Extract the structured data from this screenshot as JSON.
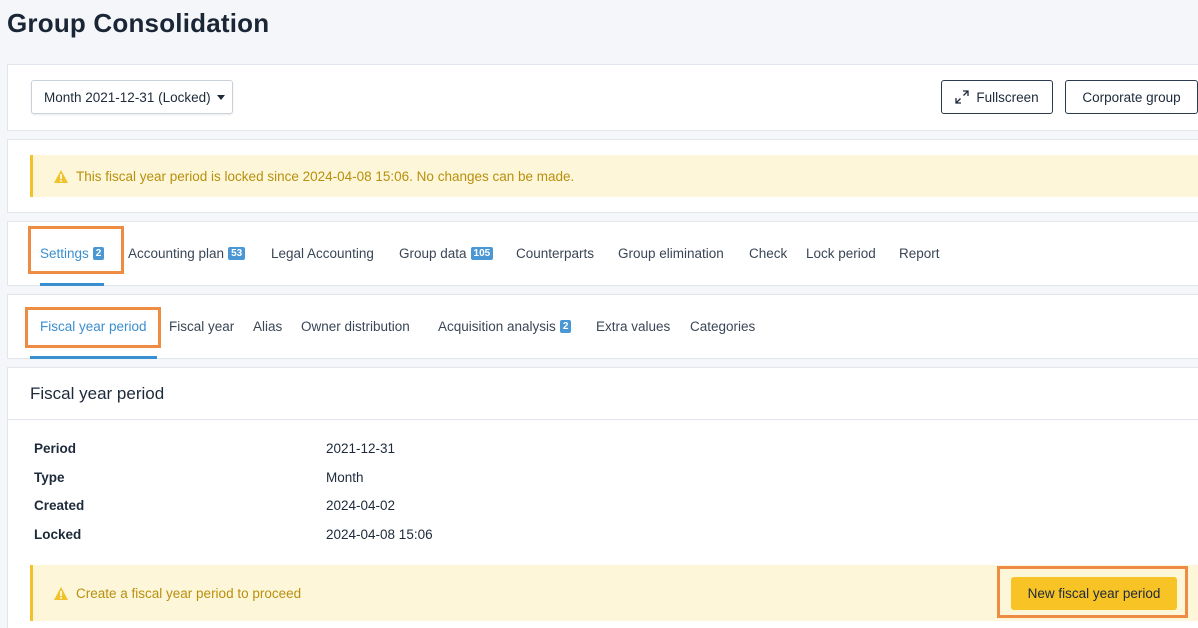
{
  "page": {
    "title": "Group Consolidation"
  },
  "toolbar": {
    "period_select": "Month 2021-12-31 (Locked)",
    "fullscreen_label": "Fullscreen",
    "corporate_group_label": "Corporate group"
  },
  "lock_alert": {
    "text": "This fiscal year period is locked since 2024-04-08 15:06. No changes can be made."
  },
  "tabs": [
    {
      "label": "Settings",
      "badge": "2"
    },
    {
      "label": "Accounting plan",
      "badge": "53"
    },
    {
      "label": "Legal Accounting"
    },
    {
      "label": "Group data",
      "badge": "105"
    },
    {
      "label": "Counterparts"
    },
    {
      "label": "Group elimination"
    },
    {
      "label": "Check"
    },
    {
      "label": "Lock period"
    },
    {
      "label": "Report"
    }
  ],
  "subtabs": [
    {
      "label": "Fiscal year period"
    },
    {
      "label": "Fiscal year"
    },
    {
      "label": "Alias"
    },
    {
      "label": "Owner distribution"
    },
    {
      "label": "Acquisition analysis",
      "badge": "2"
    },
    {
      "label": "Extra values"
    },
    {
      "label": "Categories"
    }
  ],
  "detail": {
    "title": "Fiscal year period",
    "rows": [
      {
        "label": "Period",
        "value": "2021-12-31"
      },
      {
        "label": "Type",
        "value": "Month"
      },
      {
        "label": "Created",
        "value": "2024-04-02"
      },
      {
        "label": "Locked",
        "value": "2024-04-08 15:06"
      }
    ],
    "proceed_alert": "Create a fiscal year period to proceed",
    "new_period_label": "New fiscal year period"
  },
  "colors": {
    "accent": "#3a8fd0",
    "highlight": "#ee8c43",
    "warning_bg": "#fdf6d9",
    "warning_text": "#b8900e",
    "primary_button": "#f7c325"
  }
}
